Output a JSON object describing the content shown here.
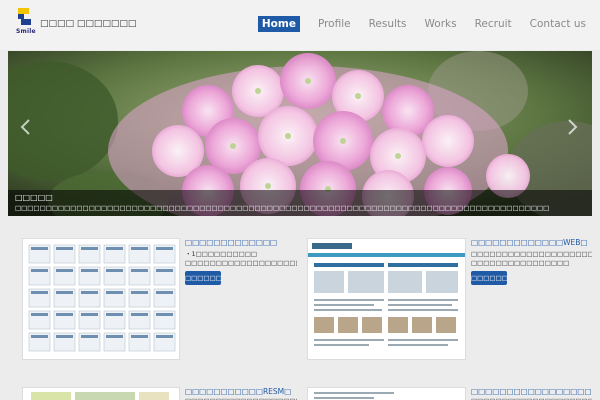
{
  "header": {
    "logo_text": "Smile",
    "site_name": "□□□□ □□□□□□□",
    "nav": [
      {
        "label": "Home",
        "active": true
      },
      {
        "label": "Profile",
        "active": false
      },
      {
        "label": "Results",
        "active": false
      },
      {
        "label": "Works",
        "active": false
      },
      {
        "label": "Recruit",
        "active": false
      },
      {
        "label": "Contact us",
        "active": false
      }
    ]
  },
  "slider": {
    "prev_icon": "chevron-left-icon",
    "next_icon": "chevron-right-icon",
    "caption_title": "□□□□□",
    "caption_text": "□□□□□□□□□□□□□□□□□□□□□□□□□□□□□□□□□□□□□□□□□□□□□□□□□□□□□□□□□□□□□□□□□□□□□□□□□□□□□□□□□□□□□□□"
  },
  "cards": [
    {
      "title": "□□□□□□□□□□□□□",
      "description": "・1□□□□□□□□□□ □□□□□□□□□□□□□□□□□□□□□□□□□□□□□□□□□□　□□□",
      "button": "□□□□□□"
    },
    {
      "title": "□□□□□□□□□□□□□WEB□",
      "description": "□□□□□□□□□□□□□□□□□□□□□□□□□□□□□□□□□□□□□□□WEB□□ □□□□□□□□□□□□□□□□",
      "button": "□□□□□□"
    },
    {
      "title": "□□□□□□□□□□□RESM□",
      "description": "□□□□□□□□□□□□□□□□□□□□□□□□□□□□□□□□□",
      "button": ""
    },
    {
      "title": "□□□□□□□□□□□□□□□□□",
      "description": "□□□□□□□□□□□□□□□□□□□□□□□□□□□□□□□□□",
      "button": ""
    }
  ],
  "colors": {
    "accent": "#1f5aa6",
    "background": "#ececec",
    "nav_text": "#8a8a8a"
  }
}
